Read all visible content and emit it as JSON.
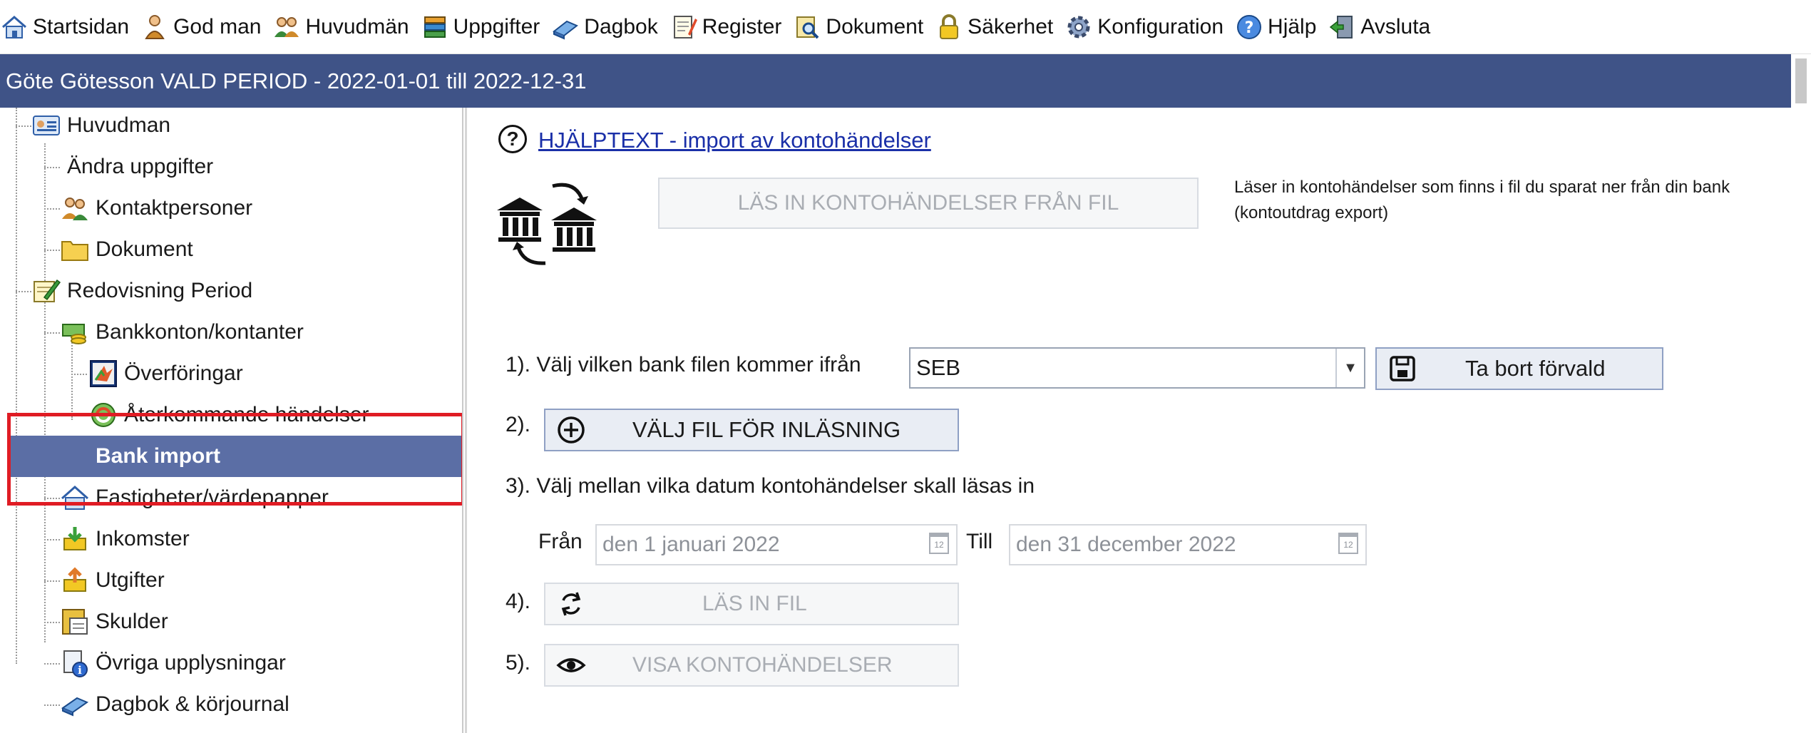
{
  "menu": {
    "items": [
      {
        "label": "Startsidan",
        "icon": "home-icon"
      },
      {
        "label": "God man",
        "icon": "person-icon"
      },
      {
        "label": "Huvudmän",
        "icon": "people-icon"
      },
      {
        "label": "Uppgifter",
        "icon": "stack-icon"
      },
      {
        "label": "Dagbok",
        "icon": "book-icon"
      },
      {
        "label": "Register",
        "icon": "notepad-icon"
      },
      {
        "label": "Dokument",
        "icon": "document-search-icon"
      },
      {
        "label": "Säkerhet",
        "icon": "lock-icon"
      },
      {
        "label": "Konfiguration",
        "icon": "gear-icon"
      },
      {
        "label": "Hjälp",
        "icon": "help-icon"
      },
      {
        "label": "Avsluta",
        "icon": "exit-door-icon"
      }
    ]
  },
  "titlebar": {
    "text": "Göte Götesson  VALD PERIOD - 2022-01-01 till 2022-12-31"
  },
  "tree": {
    "items": [
      {
        "label": "Huvudman",
        "icon": "id-card-icon"
      },
      {
        "label": "Ändra uppgifter",
        "icon": ""
      },
      {
        "label": "Kontaktpersoner",
        "icon": "contacts-icon"
      },
      {
        "label": "Dokument",
        "icon": "folder-icon"
      },
      {
        "label": "Redovisning Period",
        "icon": "edit-notepad-icon"
      },
      {
        "label": "Bankkonton/kontanter",
        "icon": "money-icon"
      },
      {
        "label": "Överföringar",
        "icon": "transfer-icon"
      },
      {
        "label": "Återkommande händelser",
        "icon": "recurring-icon"
      },
      {
        "label": "Bank import",
        "icon": ""
      },
      {
        "label": "Fastigheter/värdepapper",
        "icon": "house-icon"
      },
      {
        "label": "Inkomster",
        "icon": "income-icon"
      },
      {
        "label": "Utgifter",
        "icon": "expense-icon"
      },
      {
        "label": "Skulder",
        "icon": "debt-icon"
      },
      {
        "label": "Övriga upplysningar",
        "icon": "info-icon"
      },
      {
        "label": "Dagbok & körjournal",
        "icon": "book-icon"
      }
    ]
  },
  "main": {
    "help_link": "HJÄLPTEXT  -  import  av  kontohändelser",
    "load_button": "LÄS IN KONTOHÄNDELSER FRÅN FIL",
    "load_description": "Läser in kontohändelser som finns i fil du sparat ner från din bank (kontoutdrag export)",
    "step1_label": "1). Välj vilken bank filen kommer ifrån",
    "bank_selected": "SEB",
    "remove_default_button": "Ta bort förvald",
    "step2_label": "2).",
    "choose_file_button": "VÄLJ FIL FÖR INLÄSNING",
    "step3_label": "3). Välj mellan vilka datum kontohändelser skall läsas in",
    "from_label": "Från",
    "from_date": "den 1 januari 2022",
    "to_label": "Till",
    "to_date": "den 31 december 2022",
    "calendar_day": "12",
    "step4_label": "4).",
    "read_file_button": "LÄS IN FIL",
    "step5_label": "5).",
    "show_transactions_button": "VISA KONTOHÄNDELSER"
  },
  "colors": {
    "titlebar": "#3f5387",
    "selected": "#5b6ea5",
    "highlight": "#e01c24",
    "link": "#1a2fa8"
  }
}
